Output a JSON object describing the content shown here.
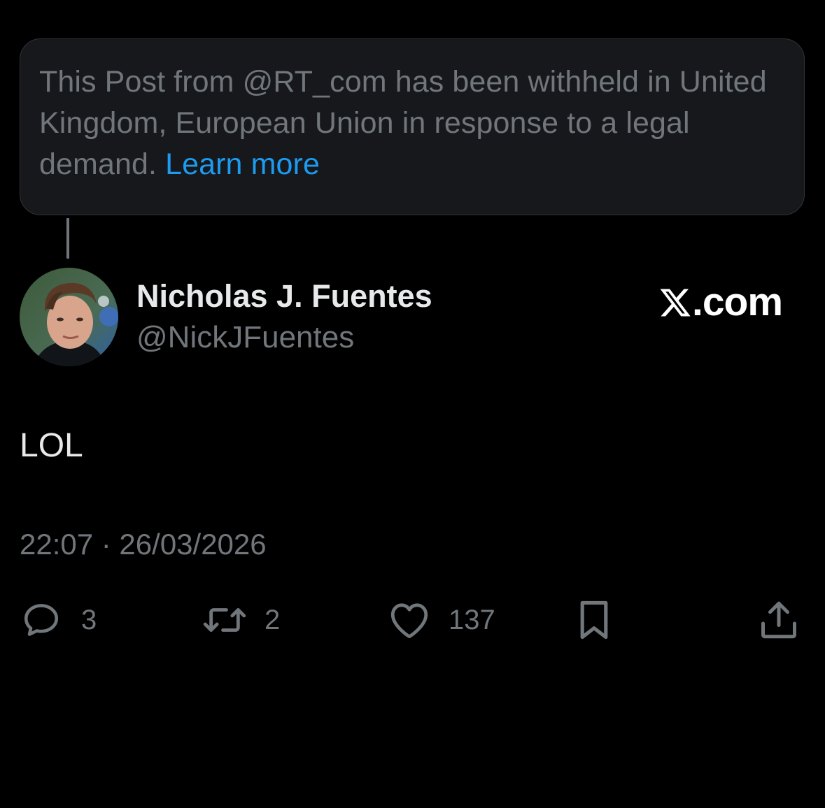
{
  "withheld_notice": {
    "text": "This Post from @RT_com has been withheld in United Kingdom, European Union in response to a legal demand.",
    "link_label": "Learn more"
  },
  "author": {
    "display_name": "Nicholas J. Fuentes",
    "handle": "@NickJFuentes",
    "avatar_icon": "profile-photo"
  },
  "brand": {
    "label": ".com",
    "icon": "x-logo-icon"
  },
  "post": {
    "text": "LOL",
    "timestamp": "22:07 · 26/03/2026"
  },
  "actions": {
    "replies": "3",
    "reposts": "2",
    "likes": "137"
  },
  "colors": {
    "background": "#000000",
    "card_background": "#16181c",
    "muted_text": "#71767b",
    "primary_text": "#e7e9ea",
    "link": "#1d9bf0"
  }
}
